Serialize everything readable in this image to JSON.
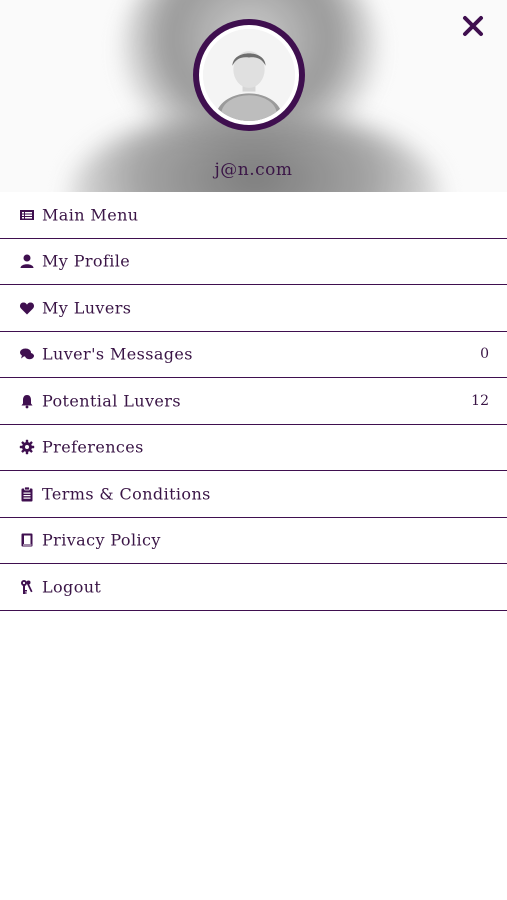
{
  "header": {
    "email": "j@n.com",
    "close_icon": "close-icon",
    "avatar": "default-user-avatar"
  },
  "menu": {
    "items": [
      {
        "label": "Main Menu",
        "icon": "list-icon",
        "count": ""
      },
      {
        "label": "My Profile",
        "icon": "user-icon",
        "count": ""
      },
      {
        "label": "My Luvers",
        "icon": "heart-icon",
        "count": ""
      },
      {
        "label": "Luver's Messages",
        "icon": "chat-icon",
        "count": "0"
      },
      {
        "label": "Potential Luvers",
        "icon": "bell-icon",
        "count": "12"
      },
      {
        "label": "Preferences",
        "icon": "gear-icon",
        "count": ""
      },
      {
        "label": "Terms & Conditions",
        "icon": "clipboard-icon",
        "count": ""
      },
      {
        "label": "Privacy Policy",
        "icon": "book-icon",
        "count": ""
      },
      {
        "label": "Logout",
        "icon": "keys-icon",
        "count": ""
      }
    ]
  },
  "colors": {
    "accent": "#3f0f4f",
    "text": "#3a1546",
    "background": "#ffffff"
  }
}
